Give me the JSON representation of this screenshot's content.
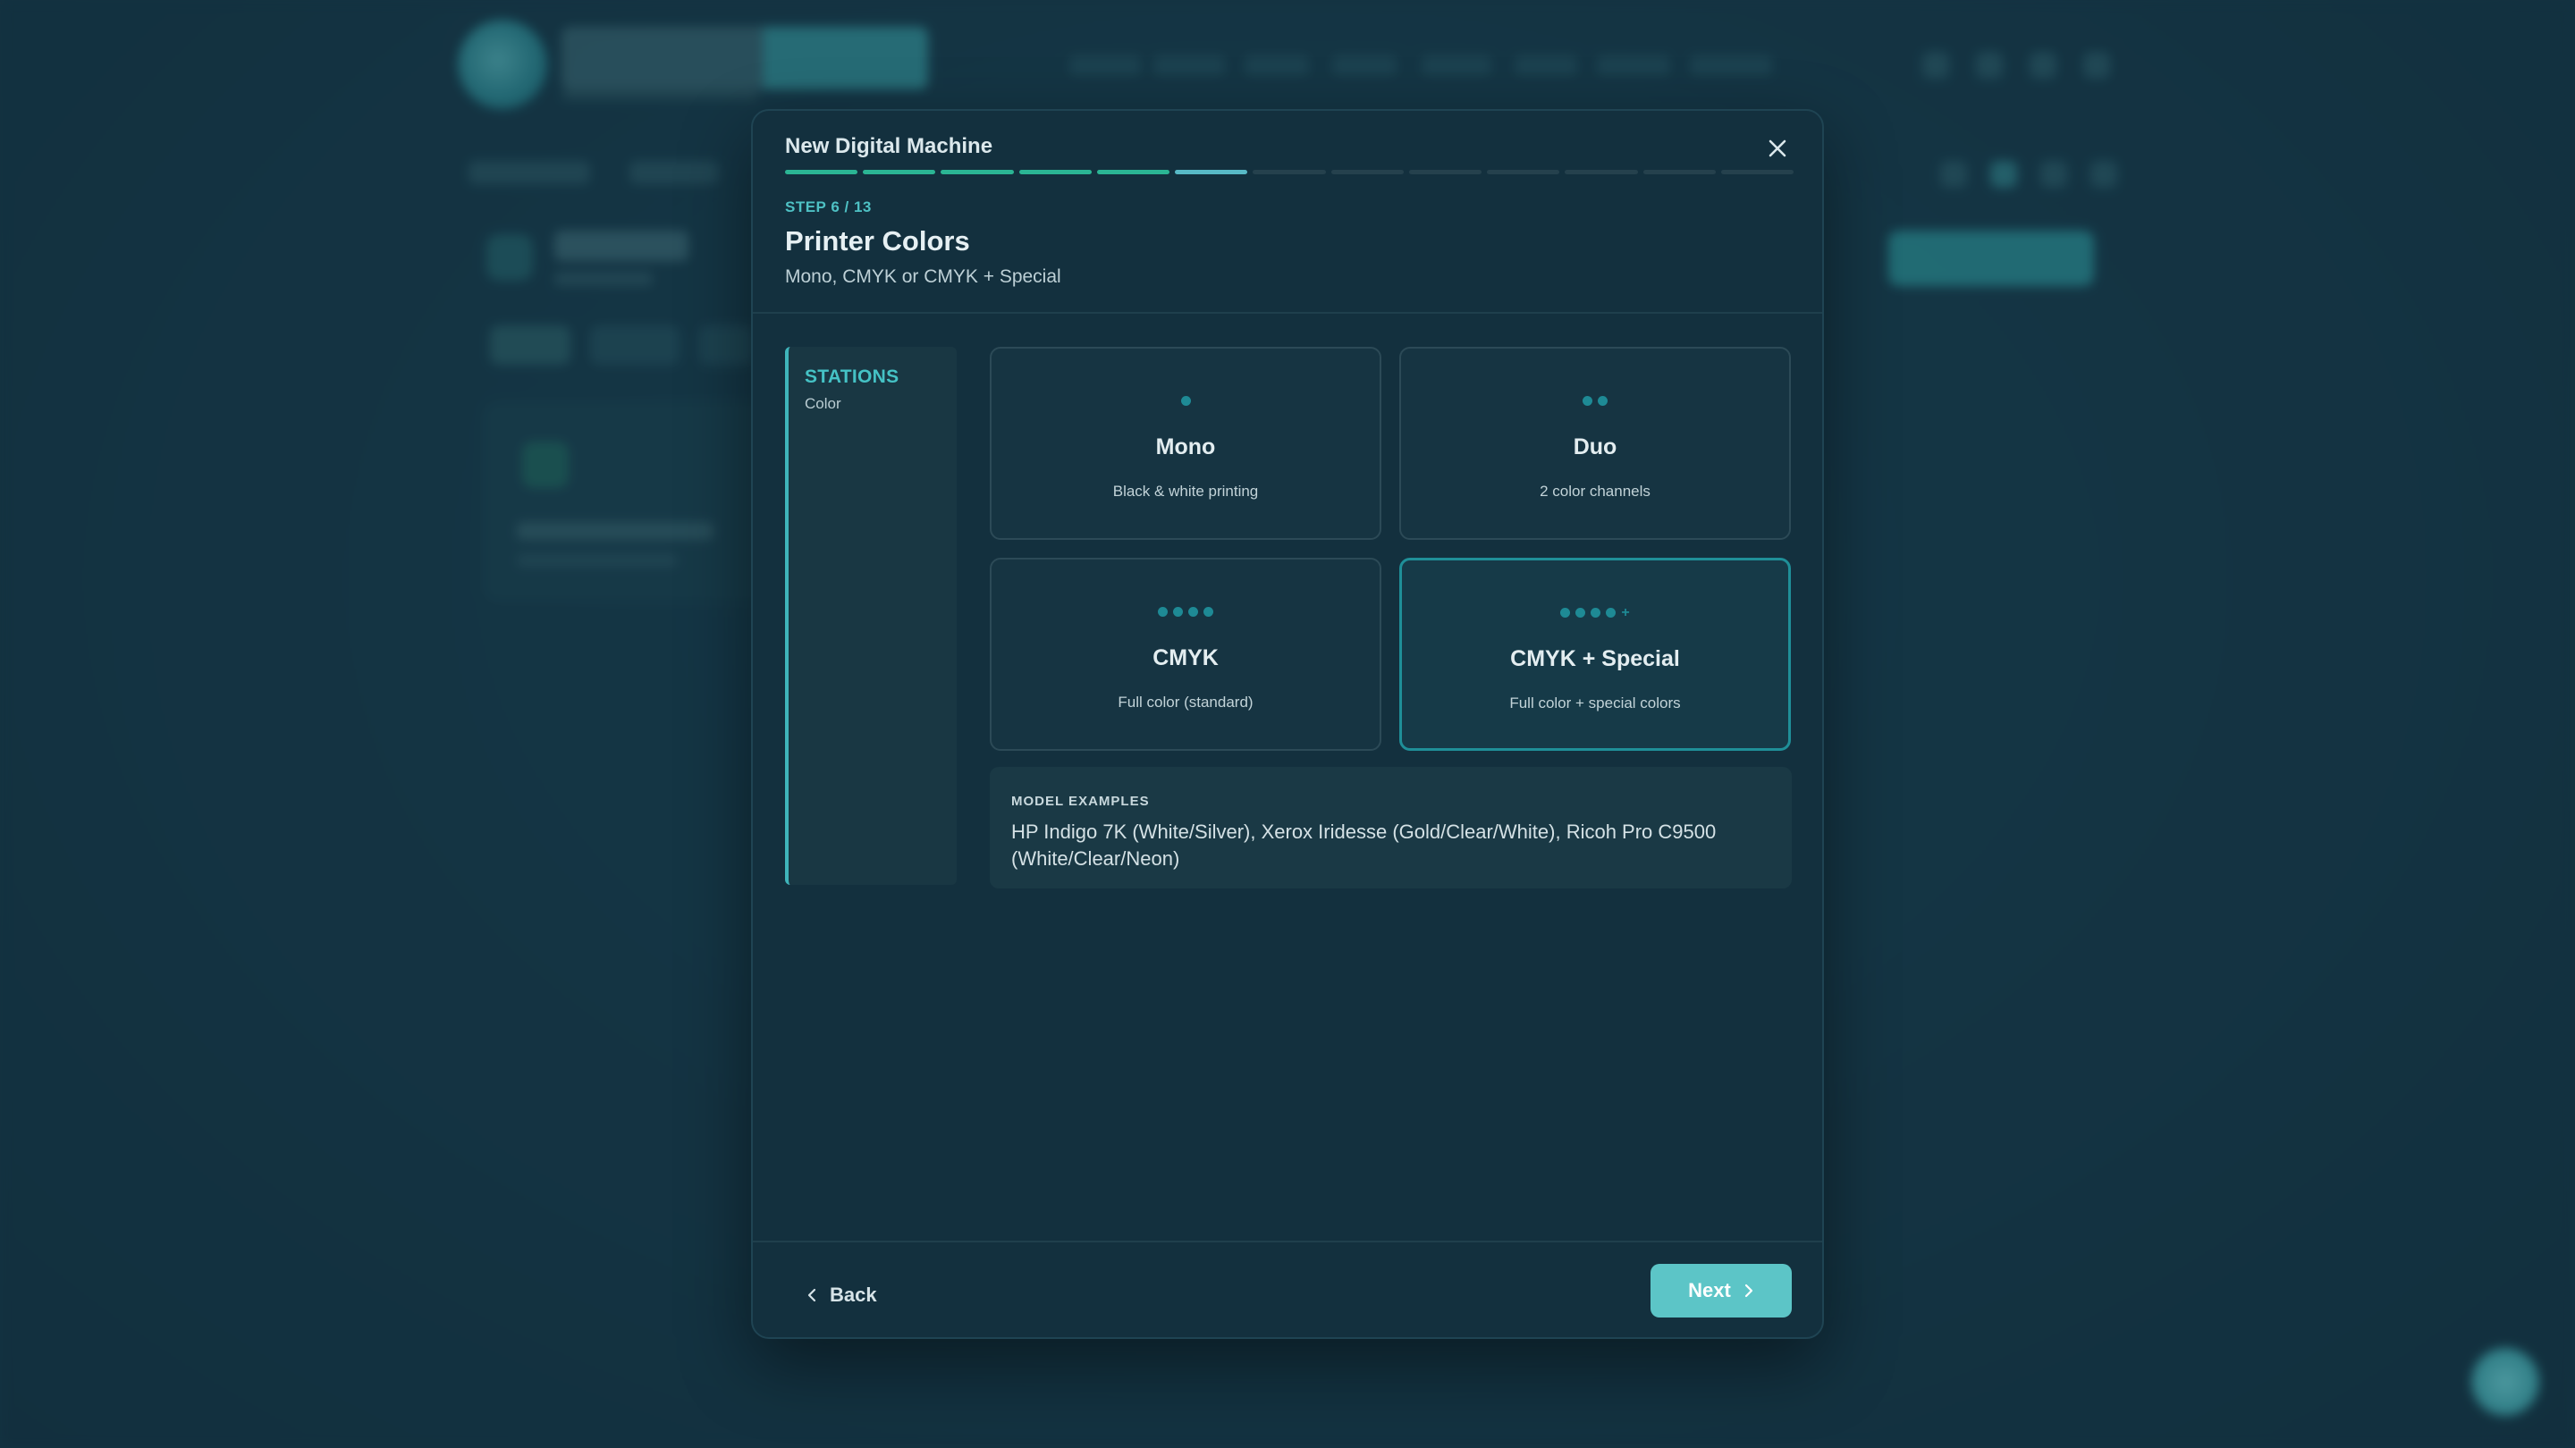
{
  "dialog": {
    "title": "New Digital Machine",
    "progress": {
      "current_step": 6,
      "total_steps": 13
    },
    "step_label": "STEP 6 / 13",
    "step_title": "Printer Colors",
    "step_description": "Mono, CMYK or CMYK + Special"
  },
  "stations_panel": {
    "title": "STATIONS",
    "subtitle": "Color"
  },
  "options": [
    {
      "name": "Mono",
      "description": "Black & white printing",
      "dots": 1,
      "plus": false,
      "selected": false
    },
    {
      "name": "Duo",
      "description": "2 color channels",
      "dots": 2,
      "plus": false,
      "selected": false
    },
    {
      "name": "CMYK",
      "description": "Full color (standard)",
      "dots": 4,
      "plus": false,
      "selected": false
    },
    {
      "name": "CMYK + Special",
      "description": "Full color + special colors",
      "dots": 4,
      "plus": true,
      "selected": true
    }
  ],
  "model_examples": {
    "title": "MODEL EXAMPLES",
    "text": "HP Indigo 7K (White/Silver), Xerox Iridesse (Gold/Clear/White), Ricoh Pro C9500 (White/Clear/Neon)"
  },
  "footer": {
    "back_label": "Back",
    "next_label": "Next"
  },
  "colors": {
    "accent": "#5cc5c7",
    "progress_done": "#2bb594",
    "progress_current": "#58b9c6",
    "selected_border": "#1f8f98"
  },
  "icons": {
    "close": "close-icon",
    "back": "chevron-left-icon",
    "next": "chevron-right-icon"
  }
}
